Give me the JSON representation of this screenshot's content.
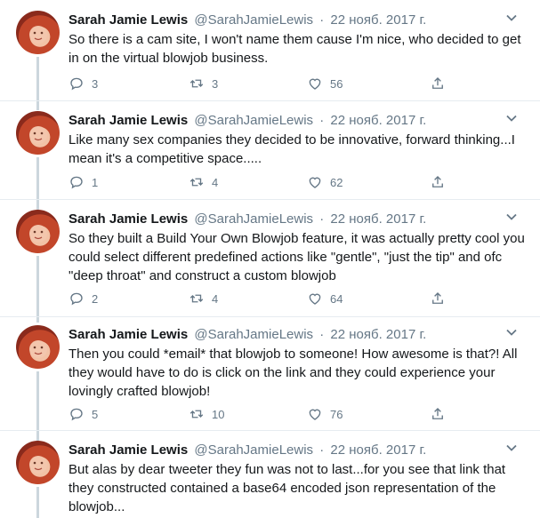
{
  "tweets": [
    {
      "name": "Sarah Jamie Lewis",
      "handle": "@SarahJamieLewis",
      "sep": "·",
      "date": "22 нояб. 2017 г.",
      "text": "So there is a cam site, I won't name them cause I'm nice, who decided to get in on the virtual blowjob business.",
      "replies": "3",
      "retweets": "3",
      "likes": "56"
    },
    {
      "name": "Sarah Jamie Lewis",
      "handle": "@SarahJamieLewis",
      "sep": "·",
      "date": "22 нояб. 2017 г.",
      "text": "Like many sex companies they decided to be innovative, forward thinking...I mean it's a competitive space.....",
      "replies": "1",
      "retweets": "4",
      "likes": "62"
    },
    {
      "name": "Sarah Jamie Lewis",
      "handle": "@SarahJamieLewis",
      "sep": "·",
      "date": "22 нояб. 2017 г.",
      "text": "So they built a Build Your Own Blowjob feature, it was actually pretty cool you could select different predefined actions like \"gentle\", \"just the tip\" and ofc \"deep throat\" and construct a custom blowjob",
      "replies": "2",
      "retweets": "4",
      "likes": "64"
    },
    {
      "name": "Sarah Jamie Lewis",
      "handle": "@SarahJamieLewis",
      "sep": "·",
      "date": "22 нояб. 2017 г.",
      "text": "Then you could *email* that blowjob to someone! How awesome is that?! All they would have to do is click on the link and they could experience your lovingly crafted blowjob!",
      "replies": "5",
      "retweets": "10",
      "likes": "76"
    },
    {
      "name": "Sarah Jamie Lewis",
      "handle": "@SarahJamieLewis",
      "sep": "·",
      "date": "22 нояб. 2017 г.",
      "text": "But alas by dear tweeter they fun was not to last...for you see that link that they constructed contained a base64 encoded json representation of the blowjob...",
      "replies": "",
      "retweets": "",
      "likes": ""
    }
  ],
  "icons": {
    "reply": "reply-icon",
    "retweet": "retweet-icon",
    "like": "heart-icon",
    "share": "share-icon",
    "menu": "chevron-down-icon"
  },
  "colors": {
    "muted": "#657786",
    "text": "#14171a",
    "thread_line": "#ccd6dd",
    "separator": "#e6ecf0"
  }
}
